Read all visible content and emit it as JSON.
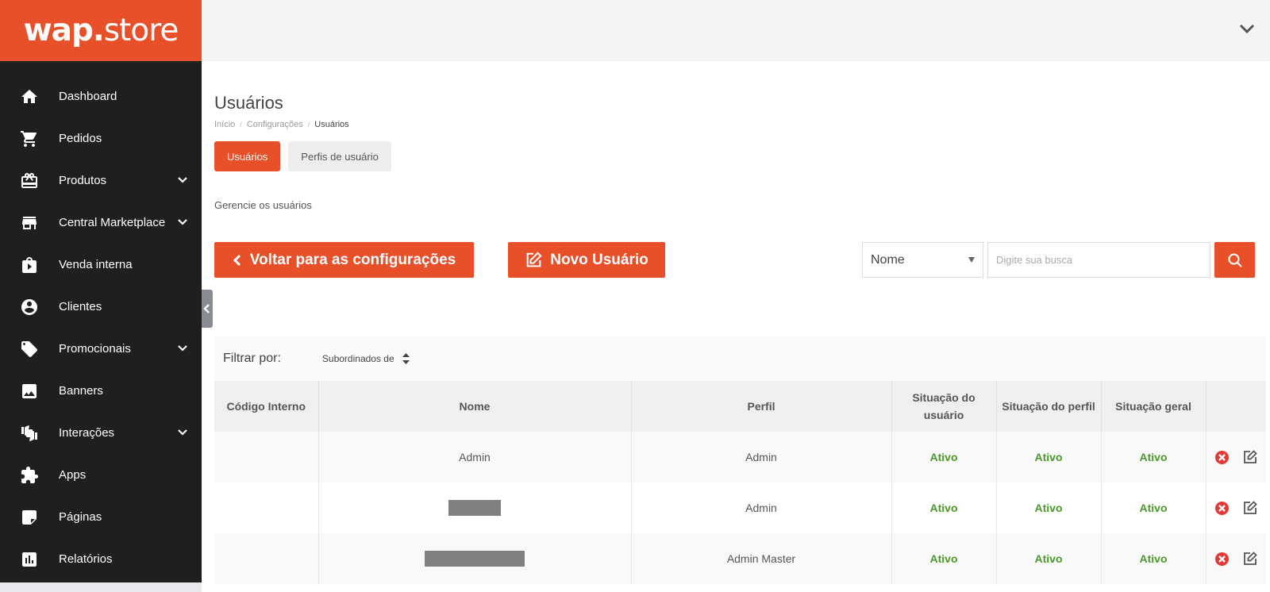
{
  "brand": {
    "logo_wap": "wap",
    "logo_dot": ".",
    "logo_store": "store",
    "accent": "#e8502a"
  },
  "sidebar": {
    "items": [
      {
        "label": "Dashboard",
        "icon": "home-icon",
        "has_submenu": false
      },
      {
        "label": "Pedidos",
        "icon": "cart-icon",
        "has_submenu": false
      },
      {
        "label": "Produtos",
        "icon": "gift-box-icon",
        "has_submenu": true
      },
      {
        "label": "Central Marketplace",
        "icon": "storefront-icon",
        "has_submenu": true
      },
      {
        "label": "Venda interna",
        "icon": "play-bag-icon",
        "has_submenu": false
      },
      {
        "label": "Clientes",
        "icon": "user-circle-icon",
        "has_submenu": false
      },
      {
        "label": "Promocionais",
        "icon": "tag-icon",
        "has_submenu": true
      },
      {
        "label": "Banners",
        "icon": "image-icon",
        "has_submenu": false
      },
      {
        "label": "Interações",
        "icon": "thumbs-icon",
        "has_submenu": true
      },
      {
        "label": "Apps",
        "icon": "puzzle-icon",
        "has_submenu": false
      },
      {
        "label": "Páginas",
        "icon": "page-icon",
        "has_submenu": false
      },
      {
        "label": "Relatórios",
        "icon": "chart-icon",
        "has_submenu": false
      }
    ]
  },
  "page": {
    "title": "Usuários",
    "breadcrumb": [
      "Início",
      "Configurações",
      "Usuários"
    ],
    "tabs": [
      {
        "label": "Usuários",
        "active": true
      },
      {
        "label": "Perfis de usuário",
        "active": false
      }
    ],
    "subtitle": "Gerencie os usuários",
    "back_button": "Voltar para as configurações",
    "new_button": "Novo Usuário"
  },
  "search": {
    "field_selected": "Nome",
    "placeholder": "Digite sua busca"
  },
  "filter": {
    "label": "Filtrar por:",
    "select_value": "Subordinados de"
  },
  "table": {
    "headers": {
      "codigo": "Código Interno",
      "nome": "Nome",
      "perfil": "Perfil",
      "sit_usuario": "Situação do usuário",
      "sit_perfil": "Situação do perfil",
      "sit_geral": "Situação geral"
    },
    "rows": [
      {
        "codigo": "",
        "nome": "Admin",
        "perfil": "Admin",
        "sit_usuario": "Ativo",
        "sit_perfil": "Ativo",
        "sit_geral": "Ativo"
      },
      {
        "codigo": "",
        "nome": "",
        "perfil": "Admin",
        "sit_usuario": "Ativo",
        "sit_perfil": "Ativo",
        "sit_geral": "Ativo"
      },
      {
        "codigo": "",
        "nome": "",
        "perfil": "Admin Master",
        "sit_usuario": "Ativo",
        "sit_perfil": "Ativo",
        "sit_geral": "Ativo"
      }
    ],
    "status_color": "#4a9a2a"
  }
}
